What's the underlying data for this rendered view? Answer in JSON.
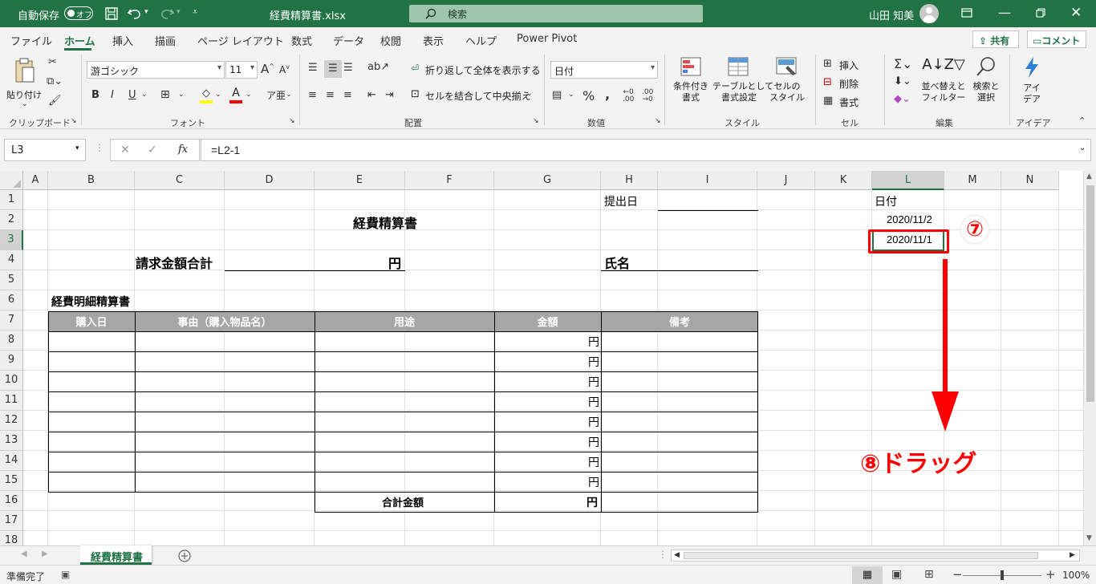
{
  "titlebar": {
    "autosave_label": "自動保存",
    "autosave_state": "オフ",
    "filename": "経費精算書.xlsx",
    "search_placeholder": "検索",
    "user_name": "山田 知美"
  },
  "ribbon_tabs": [
    "ファイル",
    "ホーム",
    "挿入",
    "描画",
    "ページ レイアウト",
    "数式",
    "データ",
    "校閲",
    "表示",
    "ヘルプ",
    "Power Pivot"
  ],
  "active_tab": "ホーム",
  "share_label": "共有",
  "comment_label": "コメント",
  "ribbon": {
    "clipboard": {
      "paste": "貼り付け",
      "group": "クリップボード"
    },
    "font": {
      "name": "游ゴシック",
      "size": "11",
      "group": "フォント",
      "bold": "B",
      "italic": "I",
      "underline": "U",
      "grow": "A",
      "shrink": "A",
      "fontcolor": "A"
    },
    "alignment": {
      "wrap": "折り返して全体を表示する",
      "merge": "セルを結合して中央揃え",
      "group": "配置"
    },
    "number": {
      "format": "日付",
      "percent": "%",
      "group": "数値"
    },
    "styles": {
      "conditional": "条件付き\n書式",
      "table": "テーブルとして\n書式設定",
      "cell_styles": "セルの\nスタイル",
      "group": "スタイル"
    },
    "cells": {
      "insert": "挿入",
      "delete": "削除",
      "format": "書式",
      "group": "セル"
    },
    "editing": {
      "sort": "並べ替えと\nフィルター",
      "find": "検索と\n選択",
      "group": "編集"
    },
    "ideas": {
      "label": "アイ\nデア",
      "group": "アイデア"
    }
  },
  "formula_bar": {
    "name_box": "L3",
    "fx": "fx",
    "formula": "=L2-1"
  },
  "columns": [
    "A",
    "B",
    "C",
    "D",
    "E",
    "F",
    "G",
    "H",
    "I",
    "J",
    "K",
    "L",
    "M",
    "N"
  ],
  "rows": [
    "1",
    "2",
    "3",
    "4",
    "5",
    "6",
    "7",
    "8",
    "9",
    "10",
    "11",
    "12",
    "13",
    "14",
    "15",
    "16",
    "17",
    "18"
  ],
  "sheet": {
    "submit_date_label": "提出日",
    "title": "経費精算書",
    "claim_total_label": "請求金額合計",
    "yen": "円",
    "name_label": "氏名",
    "detail_title": "経費明細精算書",
    "table_headers": [
      "購入日",
      "事由（購入物品名）",
      "用途",
      "金額",
      "備考"
    ],
    "row_yen": [
      "円",
      "円",
      "円",
      "円",
      "円",
      "円",
      "円",
      "円"
    ],
    "total_label": "合計金額",
    "total_yen": "円",
    "l1": "日付",
    "l2": "2020/11/2",
    "l3": "2020/11/1"
  },
  "annotations": {
    "step7": "⑦",
    "step8": "⑧ドラッグ"
  },
  "sheet_tab": "経費精算書",
  "status": {
    "ready": "準備完了",
    "zoom": "100%"
  }
}
